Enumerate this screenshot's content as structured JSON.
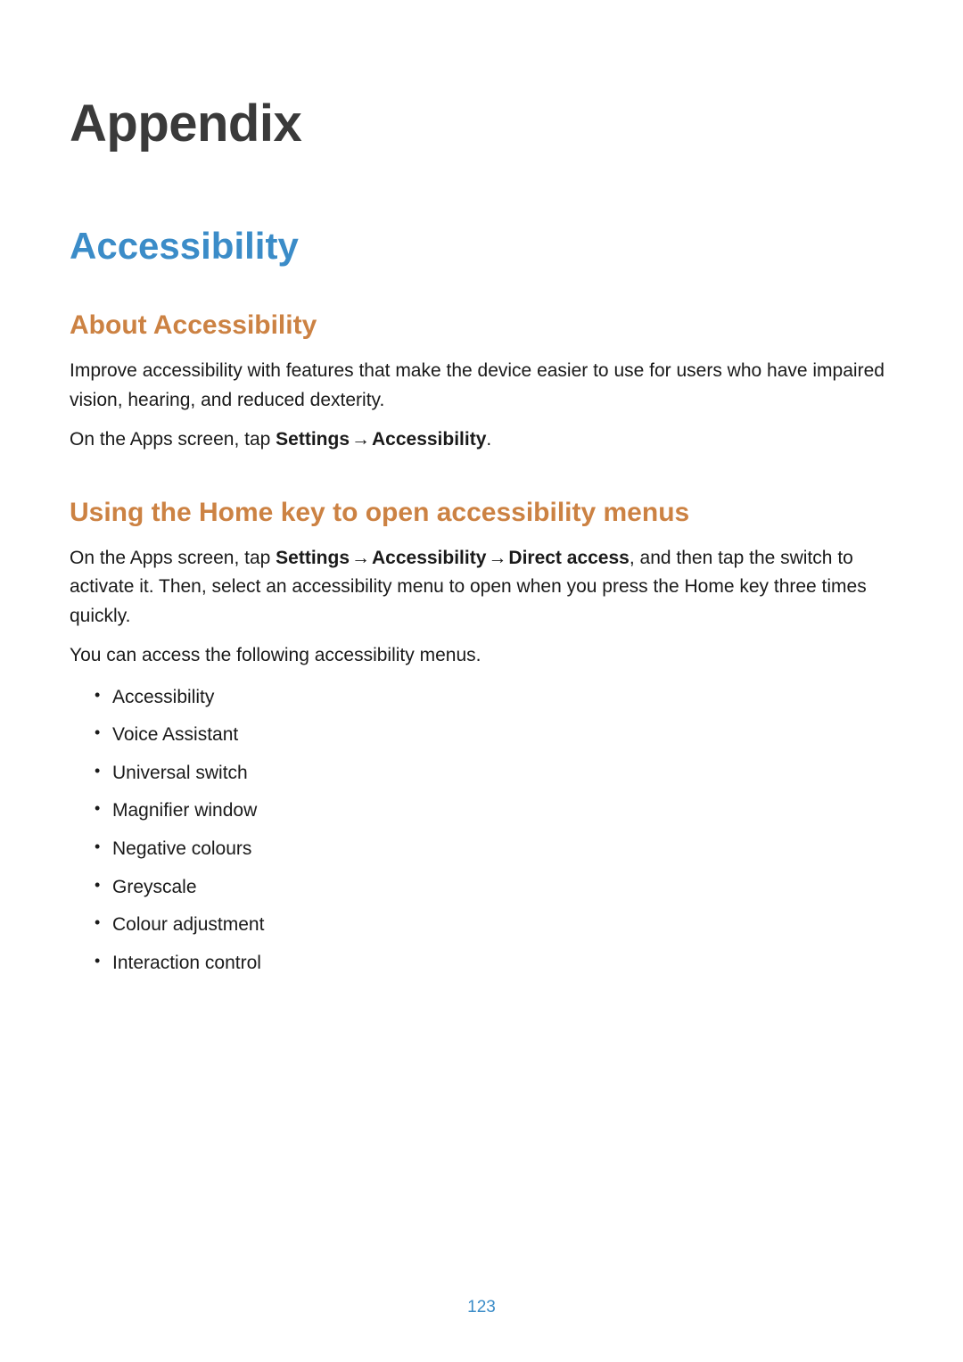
{
  "chapter_title": "Appendix",
  "section_title": "Accessibility",
  "subsection1": {
    "title": "About Accessibility",
    "para1": "Improve accessibility with features that make the device easier to use for users who have impaired vision, hearing, and reduced dexterity.",
    "para2_pre": "On the Apps screen, tap ",
    "para2_bold1": "Settings",
    "para2_arrow1": " → ",
    "para2_bold2": "Accessibility",
    "para2_post": "."
  },
  "subsection2": {
    "title": "Using the Home key to open accessibility menus",
    "para1_pre": "On the Apps screen, tap ",
    "para1_bold1": "Settings",
    "para1_arrow1": " → ",
    "para1_bold2": "Accessibility",
    "para1_arrow2": " → ",
    "para1_bold3": "Direct access",
    "para1_post": ", and then tap the switch to activate it. Then, select an accessibility menu to open when you press the Home key three times quickly.",
    "para2": "You can access the following accessibility menus.",
    "list": [
      "Accessibility",
      "Voice Assistant",
      "Universal switch",
      "Magnifier window",
      "Negative colours",
      "Greyscale",
      "Colour adjustment",
      "Interaction control"
    ]
  },
  "page_number": "123"
}
